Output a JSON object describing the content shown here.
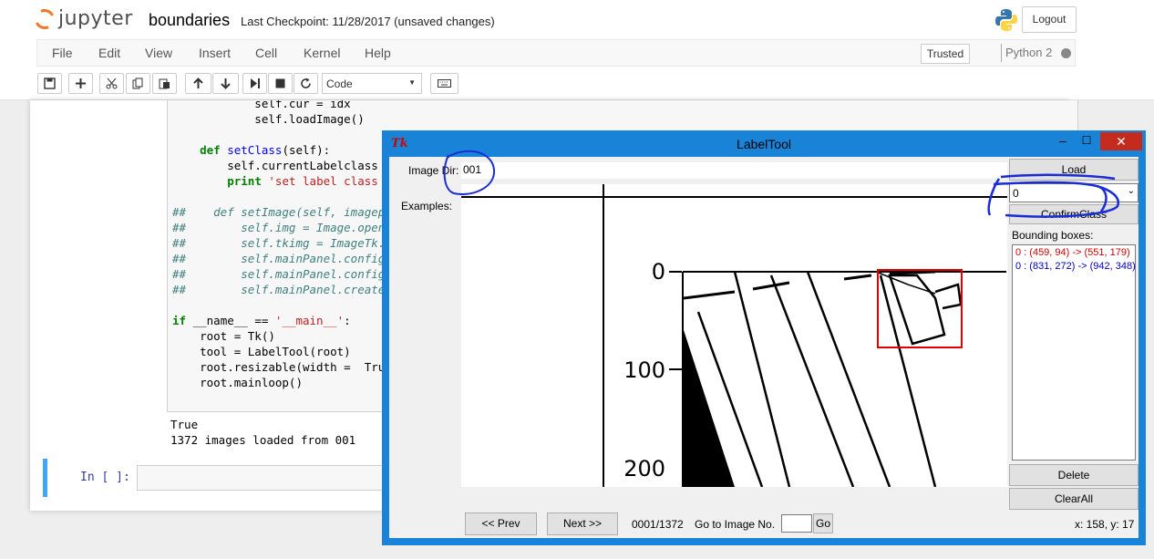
{
  "jupyter": {
    "logo_text": "jupyter",
    "notebook_name": "boundaries",
    "checkpoint": "Last Checkpoint: 11/28/2017 (unsaved changes)",
    "logout_label": "Logout",
    "menu": [
      "File",
      "Edit",
      "View",
      "Insert",
      "Cell",
      "Kernel",
      "Help"
    ],
    "trusted_label": "Trusted",
    "kernel_label": "Python 2",
    "cell_type": "Code",
    "toolbar_icons": [
      "save-icon",
      "plus-icon",
      "cut-icon",
      "copy-icon",
      "paste-icon",
      "arrow-up-icon",
      "arrow-down-icon",
      "step-forward-icon",
      "stop-icon",
      "restart-icon",
      "keyboard-icon"
    ]
  },
  "code": {
    "lines": [
      "            self.cur = idx",
      "            self.loadImage()",
      "",
      "    def setClass(self):",
      "        self.currentLabelclass = se",
      "        print 'set label class to ",
      "",
      "##    def setImage(self, imagepath",
      "##        self.img = Image.open(ima",
      "##        self.tkimg = ImageTk.Phot",
      "##        self.mainPanel.config(wid",
      "##        self.mainPanel.config(hei",
      "##        self.mainPanel.create_ima",
      "",
      "if __name__ == '__main__':",
      "    root = Tk()",
      "    tool = LabelTool(root)",
      "    root.resizable(width =  True, h",
      "    root.mainloop()"
    ],
    "output": [
      "True",
      "1372 images loaded from 001"
    ],
    "in_prompt": "In [ ]:"
  },
  "tk": {
    "title": "LabelTool",
    "image_dir_label": "Image Dir:",
    "image_dir_value": "001",
    "load_label": "Load",
    "examples_label": "Examples:",
    "class_value": "0",
    "confirm_class_label": "ConfirmClass",
    "bbox_label": "Bounding boxes:",
    "bboxes": [
      {
        "text": "0 : (459, 94) -> (551, 179)",
        "color": "#d00000"
      },
      {
        "text": "0 : (831, 272) -> (942, 348)",
        "color": "#0000c0"
      }
    ],
    "delete_label": "Delete",
    "clearall_label": "ClearAll",
    "prev_label": "<< Prev",
    "next_label": "Next >>",
    "counter": "0001/1372",
    "goto_label": "Go to Image No.",
    "go_label": "Go",
    "coords": "x: 158, y: 17",
    "axis_ticks": [
      "0",
      "100",
      "200"
    ],
    "minimize": "–",
    "maximize": "☐",
    "close": "✕"
  }
}
